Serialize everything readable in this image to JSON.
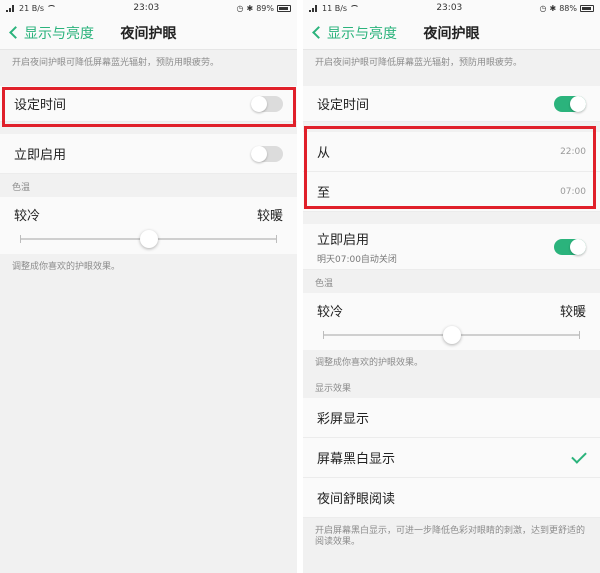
{
  "colors": {
    "accent": "#2bb37c",
    "highlight": "#e0202a"
  },
  "left": {
    "status": {
      "carrier": "21 B/s",
      "time": "23:03",
      "battery": "89%"
    },
    "nav": {
      "back_label": "显示与亮度",
      "title": "夜间护眼"
    },
    "description": "开启夜间护眼可降低屏幕蓝光辐射，预防用眼疲劳。",
    "schedule": {
      "label": "设定时间",
      "state": "off"
    },
    "enable_now": {
      "label": "立即启用",
      "state": "off"
    },
    "color_temp": {
      "group_label": "色温",
      "cool": "较冷",
      "warm": "较暖",
      "level": 0.5,
      "footer": "调整成你喜欢的护眼效果。"
    }
  },
  "right": {
    "status": {
      "carrier": "11 B/s",
      "time": "23:03",
      "battery": "88%"
    },
    "nav": {
      "back_label": "显示与亮度",
      "title": "夜间护眼"
    },
    "description": "开启夜间护眼可降低屏幕蓝光辐射，预防用眼疲劳。",
    "schedule": {
      "label": "设定时间",
      "state": "on"
    },
    "from": {
      "label": "从",
      "value": "22:00"
    },
    "to": {
      "label": "至",
      "value": "07:00"
    },
    "enable_now": {
      "label": "立即启用",
      "sub": "明天07:00自动关闭",
      "state": "on"
    },
    "color_temp": {
      "group_label": "色温",
      "cool": "较冷",
      "warm": "较暖",
      "level": 0.5,
      "footer": "调整成你喜欢的护眼效果。"
    },
    "display_effect": {
      "group_label": "显示效果",
      "options": [
        {
          "label": "彩屏显示",
          "selected": false
        },
        {
          "label": "屏幕黑白显示",
          "selected": true
        },
        {
          "label": "夜间舒眼阅读",
          "selected": false
        }
      ],
      "footer": "开启屏幕黑白显示，可进一步降低色彩对眼睛的刺激，达到更舒适的阅读效果。"
    }
  }
}
